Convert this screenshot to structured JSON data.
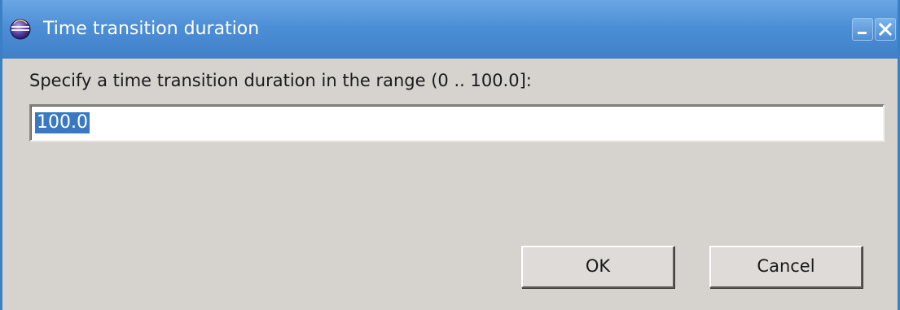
{
  "window": {
    "title": "Time transition duration",
    "titlebar_color": "#4d8fd6",
    "icons": {
      "app": "eclipse-sphere-icon",
      "minimize": "minimize-icon",
      "close": "close-icon"
    }
  },
  "dialog": {
    "prompt": "Specify a time transition duration in the range (0 .. 100.0]:",
    "input_value": "100.0",
    "input_selected": true,
    "selection_color": "#3a78c2"
  },
  "buttons": {
    "ok_label": "OK",
    "cancel_label": "Cancel"
  }
}
